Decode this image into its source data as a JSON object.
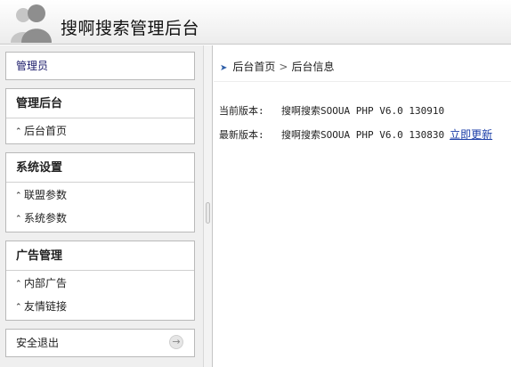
{
  "header": {
    "title": "搜啊搜索管理后台",
    "logo_icon": "users-icon"
  },
  "sidebar": {
    "admin": "管理员",
    "groups": [
      {
        "title": "管理后台",
        "items": [
          "后台首页"
        ]
      },
      {
        "title": "系统设置",
        "items": [
          "联盟参数",
          "系统参数"
        ]
      },
      {
        "title": "广告管理",
        "items": [
          "内部广告",
          "友情链接"
        ]
      }
    ],
    "logout": "安全退出"
  },
  "breadcrumb": {
    "home": "后台首页",
    "separator": ">",
    "current": "后台信息"
  },
  "info": {
    "current_label": "当前版本:",
    "current_value": "搜啊搜索SOOUA PHP V6.0 130910",
    "latest_label": "最新版本:",
    "latest_value": "搜啊搜索SOOUA PHP V6.0 130830",
    "update_link": "立即更新"
  },
  "colors": {
    "link": "#1c3fa8",
    "sidebar_bg": "#efefef",
    "accent": "#2e5fa8"
  }
}
